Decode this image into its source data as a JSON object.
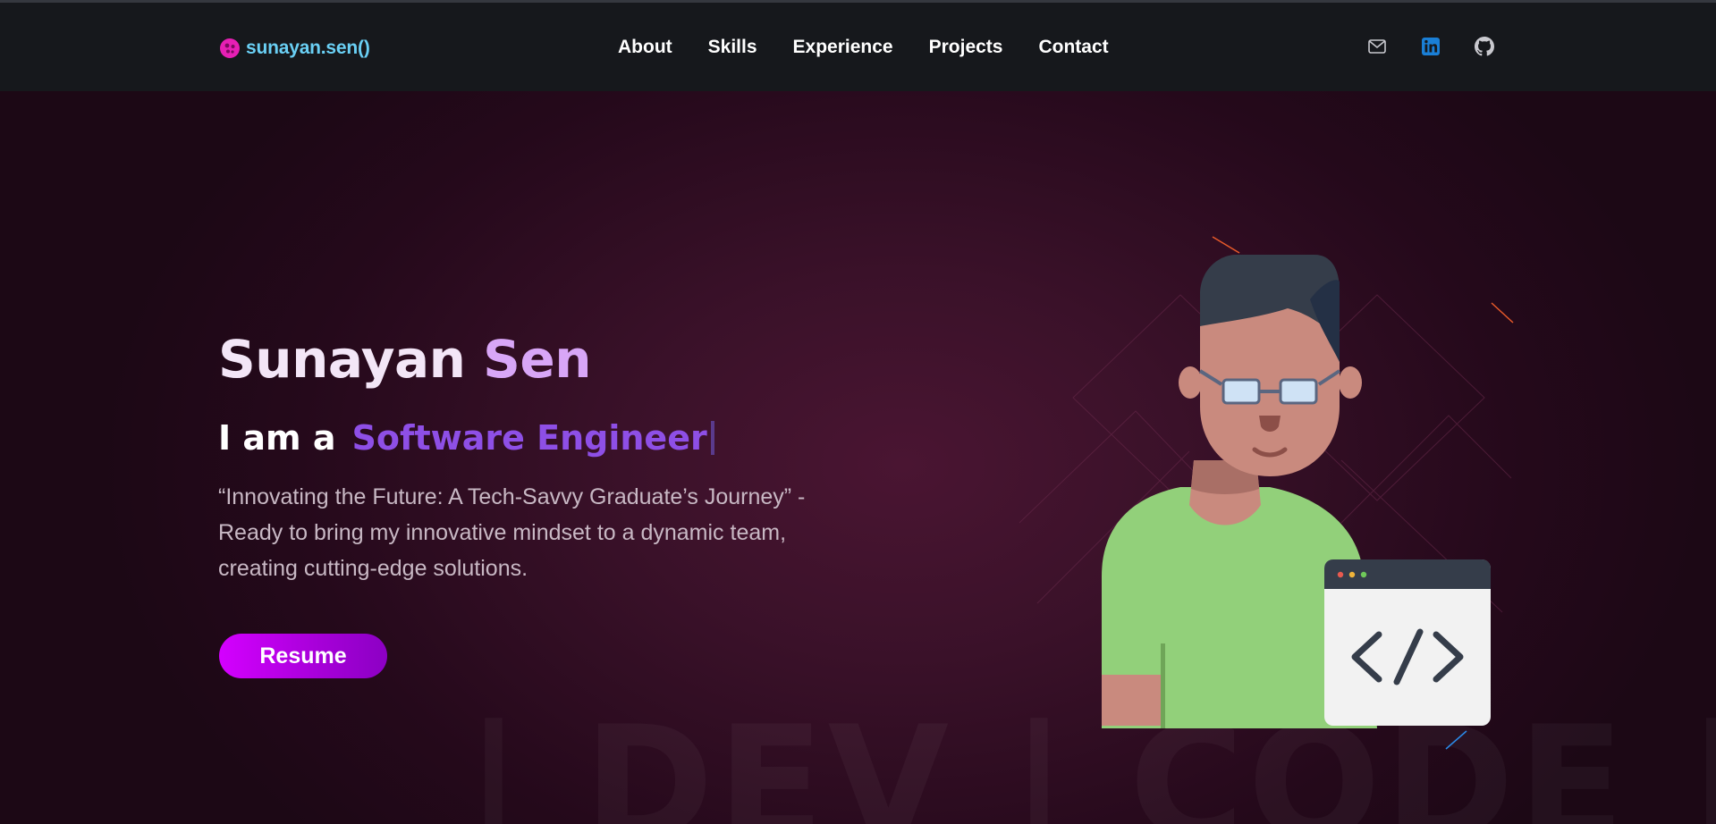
{
  "brand": {
    "logo_text": "sunayan.sen()",
    "logo_color": "#e61fb4",
    "text_color": "#6ad0f5"
  },
  "nav": {
    "items": [
      "About",
      "Skills",
      "Experience",
      "Projects",
      "Contact"
    ]
  },
  "social": [
    {
      "icon": "mail-icon",
      "color": "#c9c9cf"
    },
    {
      "icon": "linkedin-icon",
      "color": "#1a7fd6"
    },
    {
      "icon": "github-icon",
      "color": "#c9c9cf"
    }
  ],
  "hero": {
    "first_name": "Sunayan",
    "last_name": "Sen",
    "iam_prefix": "I am a",
    "role": "Software Engineer",
    "tagline": "“Innovating the Future: A Tech-Savvy Graduate’s Journey” - Ready to bring my innovative mindset to a dynamic team, creating cutting-edge solutions.",
    "resume_label": "Resume",
    "background_word": "| DEV  | CODE  | FI"
  },
  "colors": {
    "accent_pink": "#d400ff",
    "role_purple": "#8e4fe6",
    "name_light": "#f3e6f7",
    "name_lavender": "#d8a6f7",
    "shirt": "#92d07a",
    "skin": "#c98a7e",
    "hair": "#353d4a",
    "window": "#f2f2f2",
    "window_bar": "#353d4a"
  }
}
